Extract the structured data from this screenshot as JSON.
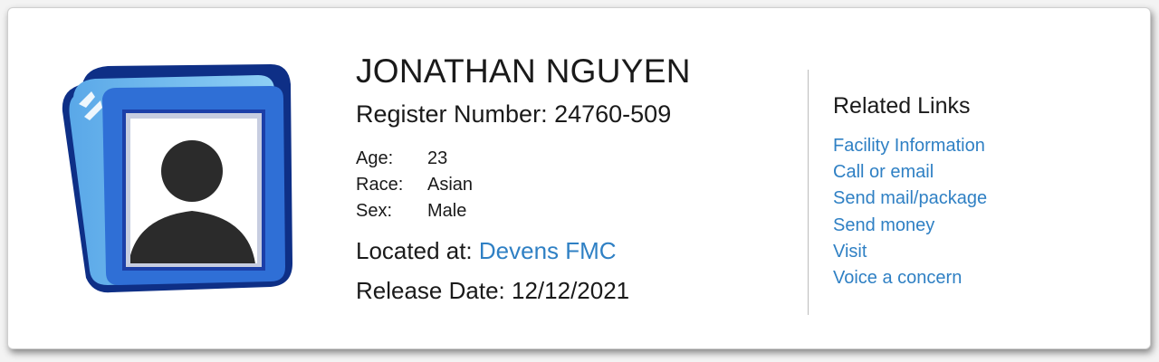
{
  "profile": {
    "avatar_icon": "person-silhouette-icon",
    "name": "JONATHAN NGUYEN",
    "register_label": "Register Number:",
    "register_number": "24760-509",
    "details": [
      {
        "label": "Age:",
        "value": "23"
      },
      {
        "label": "Race:",
        "value": "Asian"
      },
      {
        "label": "Sex:",
        "value": "Male"
      }
    ],
    "located_label": "Located at:",
    "facility": "Devens FMC",
    "release_label": "Release Date:",
    "release_date": "12/12/2021"
  },
  "related": {
    "title": "Related Links",
    "links": [
      "Facility Information",
      "Call or email",
      "Send mail/package",
      "Send money",
      "Visit",
      "Voice a concern"
    ]
  },
  "colors": {
    "link": "#2f80c4",
    "text": "#1a1a1a",
    "frame_blue": "#2f6fd6",
    "frame_dark": "#0e2f86"
  }
}
